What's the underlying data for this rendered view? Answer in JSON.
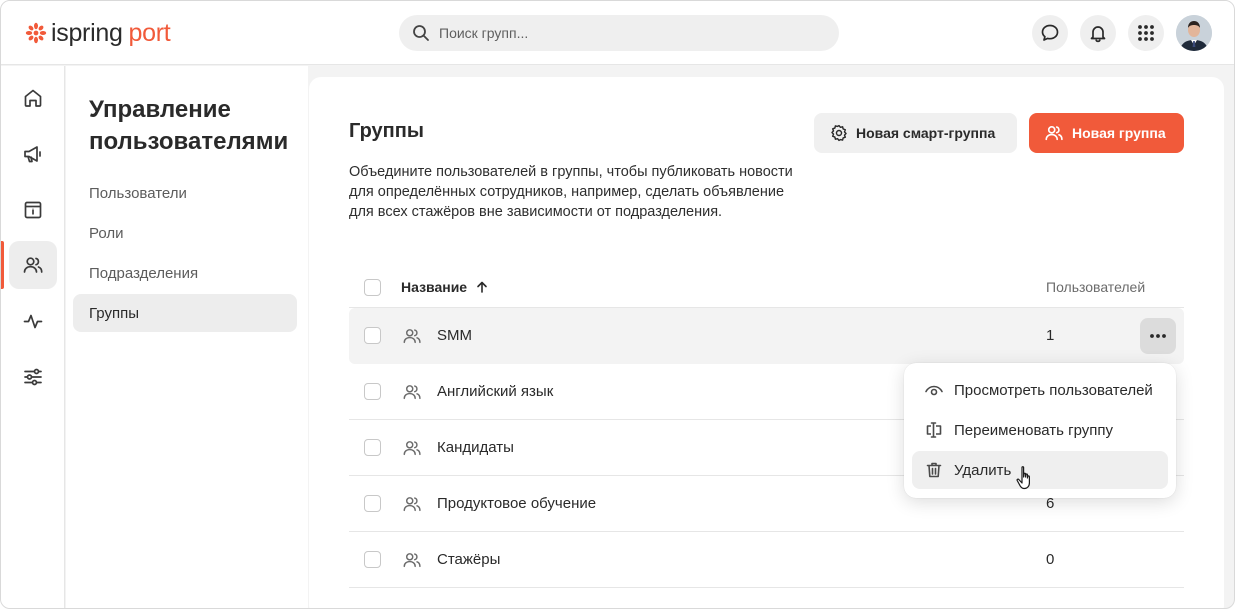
{
  "brand": {
    "name_part1": "ispring",
    "name_part2": "port",
    "accent": "#f15a3a"
  },
  "header": {
    "search": {
      "placeholder": "Поиск групп..."
    },
    "icons": [
      "chat-icon",
      "bell-icon",
      "apps-grid-icon"
    ]
  },
  "rail": {
    "items": [
      {
        "icon": "home-icon"
      },
      {
        "icon": "megaphone-icon"
      },
      {
        "icon": "info-board-icon"
      },
      {
        "icon": "users-icon",
        "active": true
      },
      {
        "icon": "activity-icon"
      },
      {
        "icon": "settings-sliders-icon"
      }
    ]
  },
  "subnav": {
    "title": "Управление пользователями",
    "items": [
      {
        "label": "Пользователи"
      },
      {
        "label": "Роли"
      },
      {
        "label": "Подразделения"
      },
      {
        "label": "Группы",
        "active": true
      }
    ]
  },
  "main": {
    "title": "Группы",
    "description": "Объедините пользователей в группы, чтобы публиковать новости для определённых сотрудников, например, сделать объявление для всех стажёров вне зависимости от подразделения.",
    "smart_group_button": "Новая смарт-группа",
    "new_group_button": "Новая группа"
  },
  "table": {
    "col_name": "Название",
    "col_users": "Пользователей",
    "rows": [
      {
        "name": "SMM",
        "count": "1"
      },
      {
        "name": "Английский язык",
        "count": ""
      },
      {
        "name": "Кандидаты",
        "count": ""
      },
      {
        "name": "Продуктовое обучение",
        "count": "6"
      },
      {
        "name": "Стажёры",
        "count": "0"
      }
    ]
  },
  "menu": {
    "items": [
      {
        "label": "Просмотреть пользователей",
        "icon": "eye-icon"
      },
      {
        "label": "Переименовать группу",
        "icon": "rename-icon"
      },
      {
        "label": "Удалить",
        "icon": "trash-icon"
      }
    ]
  }
}
